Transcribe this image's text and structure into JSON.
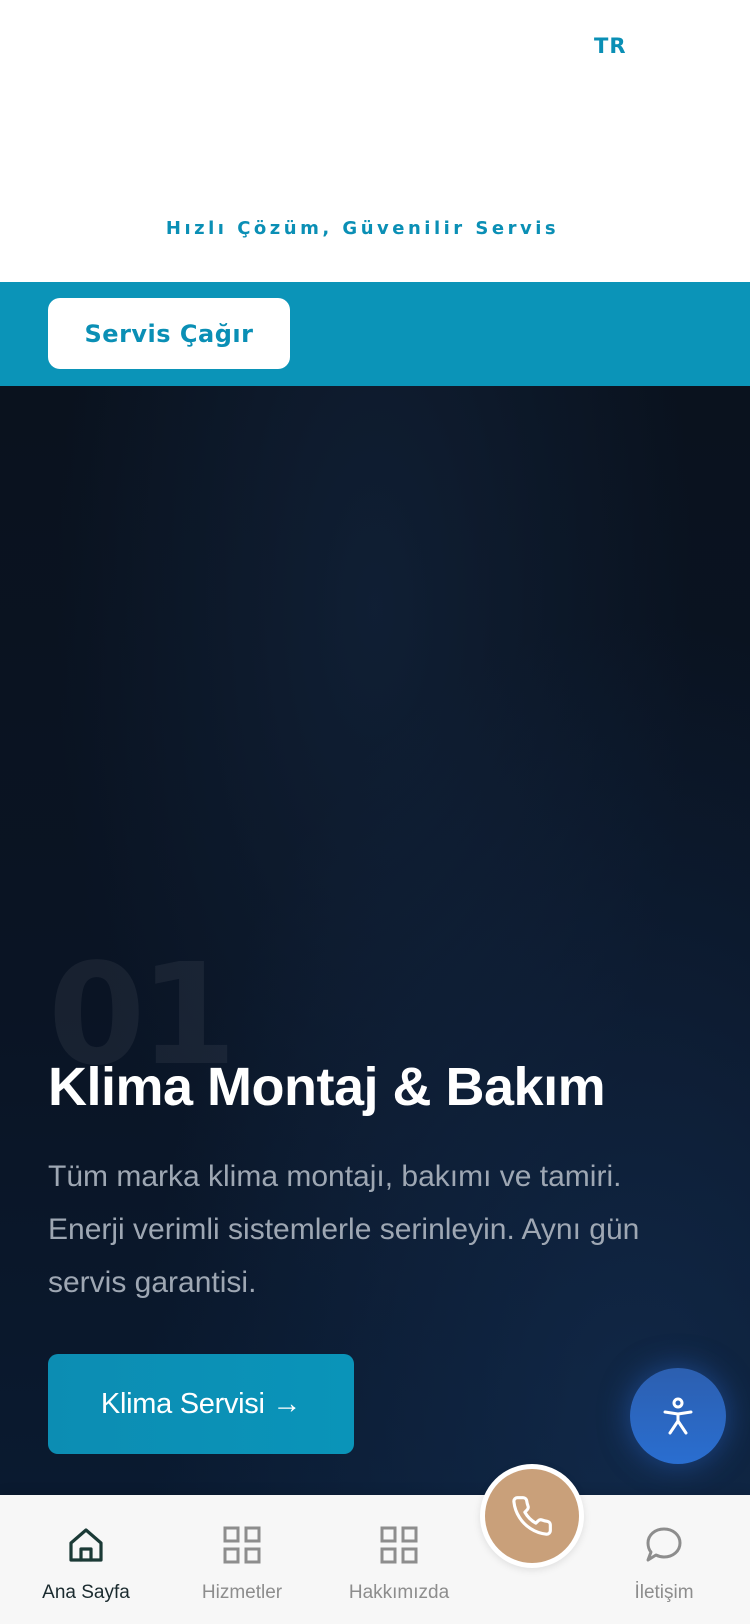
{
  "header": {
    "language": "TR",
    "tagline": "Hızlı Çözüm, Güvenilir Servis"
  },
  "service_bar": {
    "button_label": "Servis Çağır"
  },
  "hero": {
    "number": "01",
    "title": "Klima Montaj & Bakım",
    "description": "Tüm marka klima montajı, bakımı ve tamiri. Enerji verimli sistemlerle serinleyin. Aynı gün servis garantisi.",
    "cta_label": "Klima Servisi →"
  },
  "accessibility": {
    "icon": "accessibility-icon"
  },
  "bottom_nav": {
    "items": [
      {
        "label": "Ana Sayfa",
        "icon": "home-icon",
        "active": true
      },
      {
        "label": "Hizmetler",
        "icon": "grid-icon",
        "active": false
      },
      {
        "label": "Hakkımızda",
        "icon": "grid-icon",
        "active": false
      },
      {
        "label": "İletişim",
        "icon": "chat-bubble-icon",
        "active": false
      }
    ],
    "call_button": {
      "icon": "phone-icon"
    }
  },
  "colors": {
    "accent": "#0a8fb5",
    "hero_bg": "#0a1424",
    "call_button": "#c9a07a",
    "accessibility_button": "#2a6ed0",
    "nav_active": "#1b2b2f",
    "nav_inactive": "#8d8d8d"
  }
}
